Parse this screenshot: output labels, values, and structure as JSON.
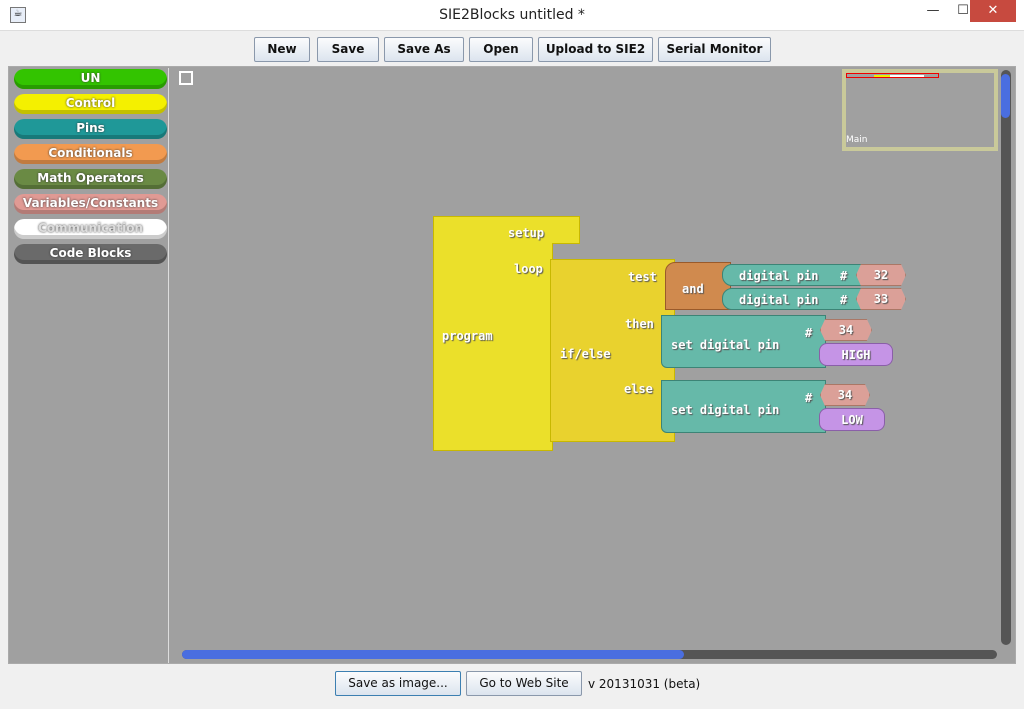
{
  "window": {
    "title": "SIE2Blocks untitled *",
    "minimize": "—",
    "maximize": "☐",
    "close": "✕"
  },
  "toolbar": {
    "new": "New",
    "save": "Save",
    "save_as": "Save As",
    "open": "Open",
    "upload": "Upload to SIE2",
    "serial": "Serial Monitor"
  },
  "sidebar": {
    "categories": [
      {
        "label": "UN",
        "color": "#33c400"
      },
      {
        "label": "Control",
        "color": "#f4f000"
      },
      {
        "label": "Pins",
        "color": "#1f9898"
      },
      {
        "label": "Conditionals",
        "color": "#f29a50"
      },
      {
        "label": "Math Operators",
        "color": "#6a8a44"
      },
      {
        "label": "Variables/Constants",
        "color": "#e09a94"
      },
      {
        "label": "Communication",
        "color": "#ffffff"
      },
      {
        "label": "Code Blocks",
        "color": "#6a6a6a"
      }
    ]
  },
  "blocks": {
    "program": "program",
    "setup": "setup",
    "loop": "loop",
    "ifelse": "if/else",
    "test": "test",
    "then": "then",
    "else": "else",
    "and": "and",
    "digital_pin": "digital pin",
    "hash": "#",
    "pin1": "32",
    "pin2": "33",
    "set_digital_pin": "set digital pin",
    "pin3": "34",
    "high": "HIGH",
    "pin4": "34",
    "low": "LOW"
  },
  "minimap": {
    "label": "Main"
  },
  "footer": {
    "save_image": "Save as image...",
    "website": "Go to Web Site",
    "version": "v 20131031 (beta)"
  }
}
